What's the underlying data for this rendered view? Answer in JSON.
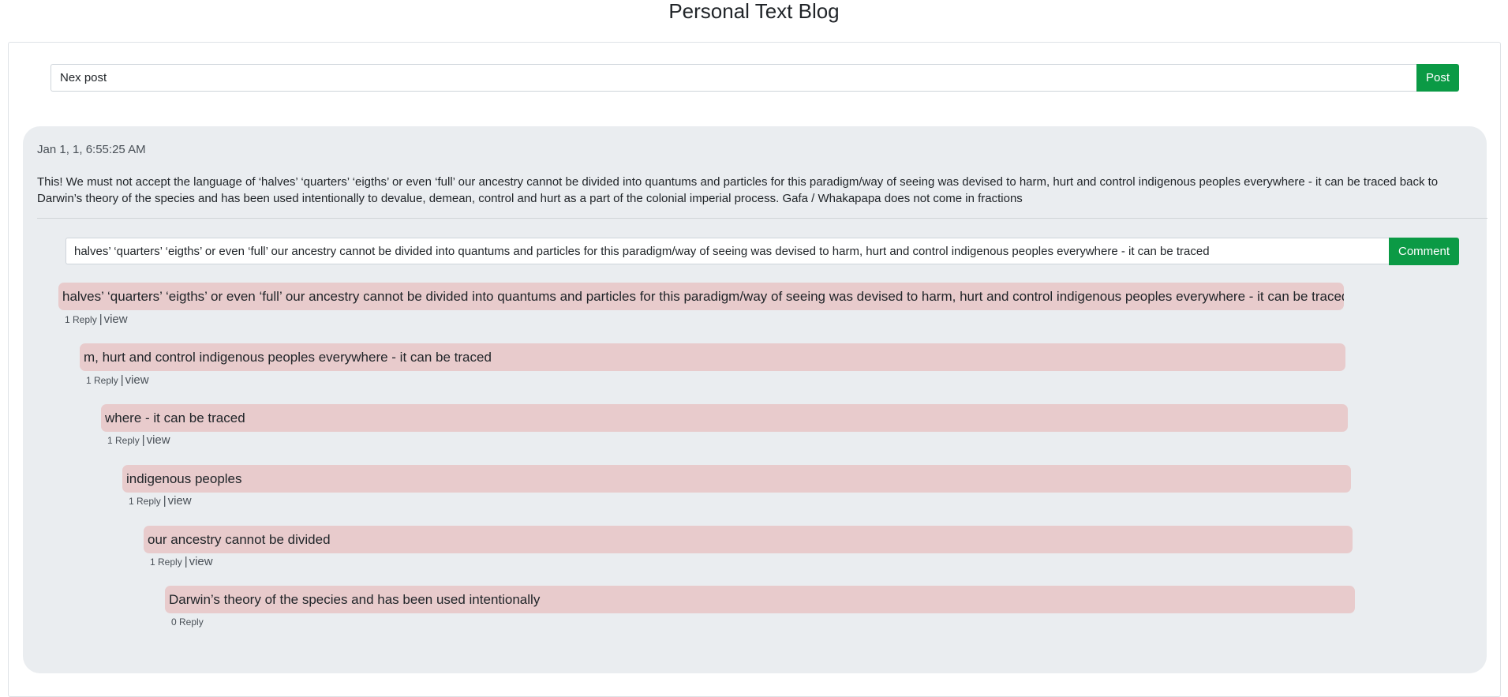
{
  "page": {
    "title": "Personal Text Blog"
  },
  "new_post": {
    "value": "Nex post",
    "button_label": "Post"
  },
  "post": {
    "date": "Jan 1, 1, 6:55:25 AM",
    "body": "This! We must not accept the language of ‘halves’ ‘quarters’ ‘eigths’ or even ‘full’ our ancestry cannot be divided into quantums and particles for this paradigm/way of seeing was devised to harm, hurt and control indigenous peoples everywhere - it can be traced back to Darwin’s theory of the species and has been used intentionally to devalue, demean, control and hurt as a part of the colonial imperial process. Gafa / Whakapapa does not come in fractions",
    "comment_input_value": "halves’ ‘quarters’ ‘eigths’ or even ‘full’ our ancestry cannot be divided into quantums and particles for this paradigm/way of seeing was devised to harm, hurt and control indigenous peoples everywhere - it can be traced",
    "comment_button_label": "Comment"
  },
  "replies": [
    {
      "text": "halves’ ‘quarters’ ‘eigths’ or even ‘full’ our ancestry cannot be divided into quantums and particles for this paradigm/way of seeing was devised to harm, hurt and control indigenous peoples everywhere - it can be traced",
      "count_label": "1 Reply",
      "separator": "|",
      "view_label": "view"
    },
    {
      "text": "m, hurt and control indigenous peoples everywhere - it can be traced",
      "count_label": "1 Reply",
      "separator": "|",
      "view_label": "view"
    },
    {
      "text": "where - it can be traced",
      "count_label": "1 Reply",
      "separator": "|",
      "view_label": "view"
    },
    {
      "text": "indigenous peoples",
      "count_label": "1 Reply",
      "separator": "|",
      "view_label": "view"
    },
    {
      "text": "our ancestry cannot be divided",
      "count_label": "1 Reply",
      "separator": "|",
      "view_label": "view"
    },
    {
      "text": "Darwin’s theory of the species and has been used intentionally",
      "count_label": "0 Reply"
    }
  ]
}
